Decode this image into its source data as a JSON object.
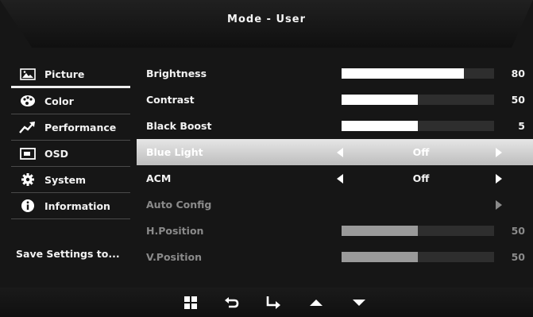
{
  "title": "Mode  -  User",
  "sidebar": {
    "items": [
      {
        "label": "Picture",
        "icon": "picture-icon",
        "active": true
      },
      {
        "label": "Color",
        "icon": "palette-icon",
        "active": false
      },
      {
        "label": "Performance",
        "icon": "trend-icon",
        "active": false
      },
      {
        "label": "OSD",
        "icon": "osd-icon",
        "active": false
      },
      {
        "label": "System",
        "icon": "gear-icon",
        "active": false
      },
      {
        "label": "Information",
        "icon": "info-icon",
        "active": false
      }
    ],
    "save_label": "Save  Settings  to..."
  },
  "settings": [
    {
      "label": "Brightness",
      "type": "slider",
      "value": "80",
      "level": 0.8
    },
    {
      "label": "Contrast",
      "type": "slider",
      "value": "50",
      "level": 0.5
    },
    {
      "label": "Black  Boost",
      "type": "slider",
      "value": "5",
      "level": 0.5
    },
    {
      "label": "Blue  Light",
      "type": "option",
      "value": "Off",
      "selected": true
    },
    {
      "label": "ACM",
      "type": "option",
      "value": "Off"
    },
    {
      "label": "Auto  Config",
      "type": "action",
      "disabled": true
    },
    {
      "label": "H.Position",
      "type": "slider",
      "value": "50",
      "level": 0.5,
      "disabled": true
    },
    {
      "label": "V.Position",
      "type": "slider",
      "value": "50",
      "level": 0.5,
      "disabled": true
    }
  ],
  "bottom_nav": [
    "menu-icon",
    "back-icon",
    "enter-icon",
    "up-icon",
    "down-icon"
  ]
}
